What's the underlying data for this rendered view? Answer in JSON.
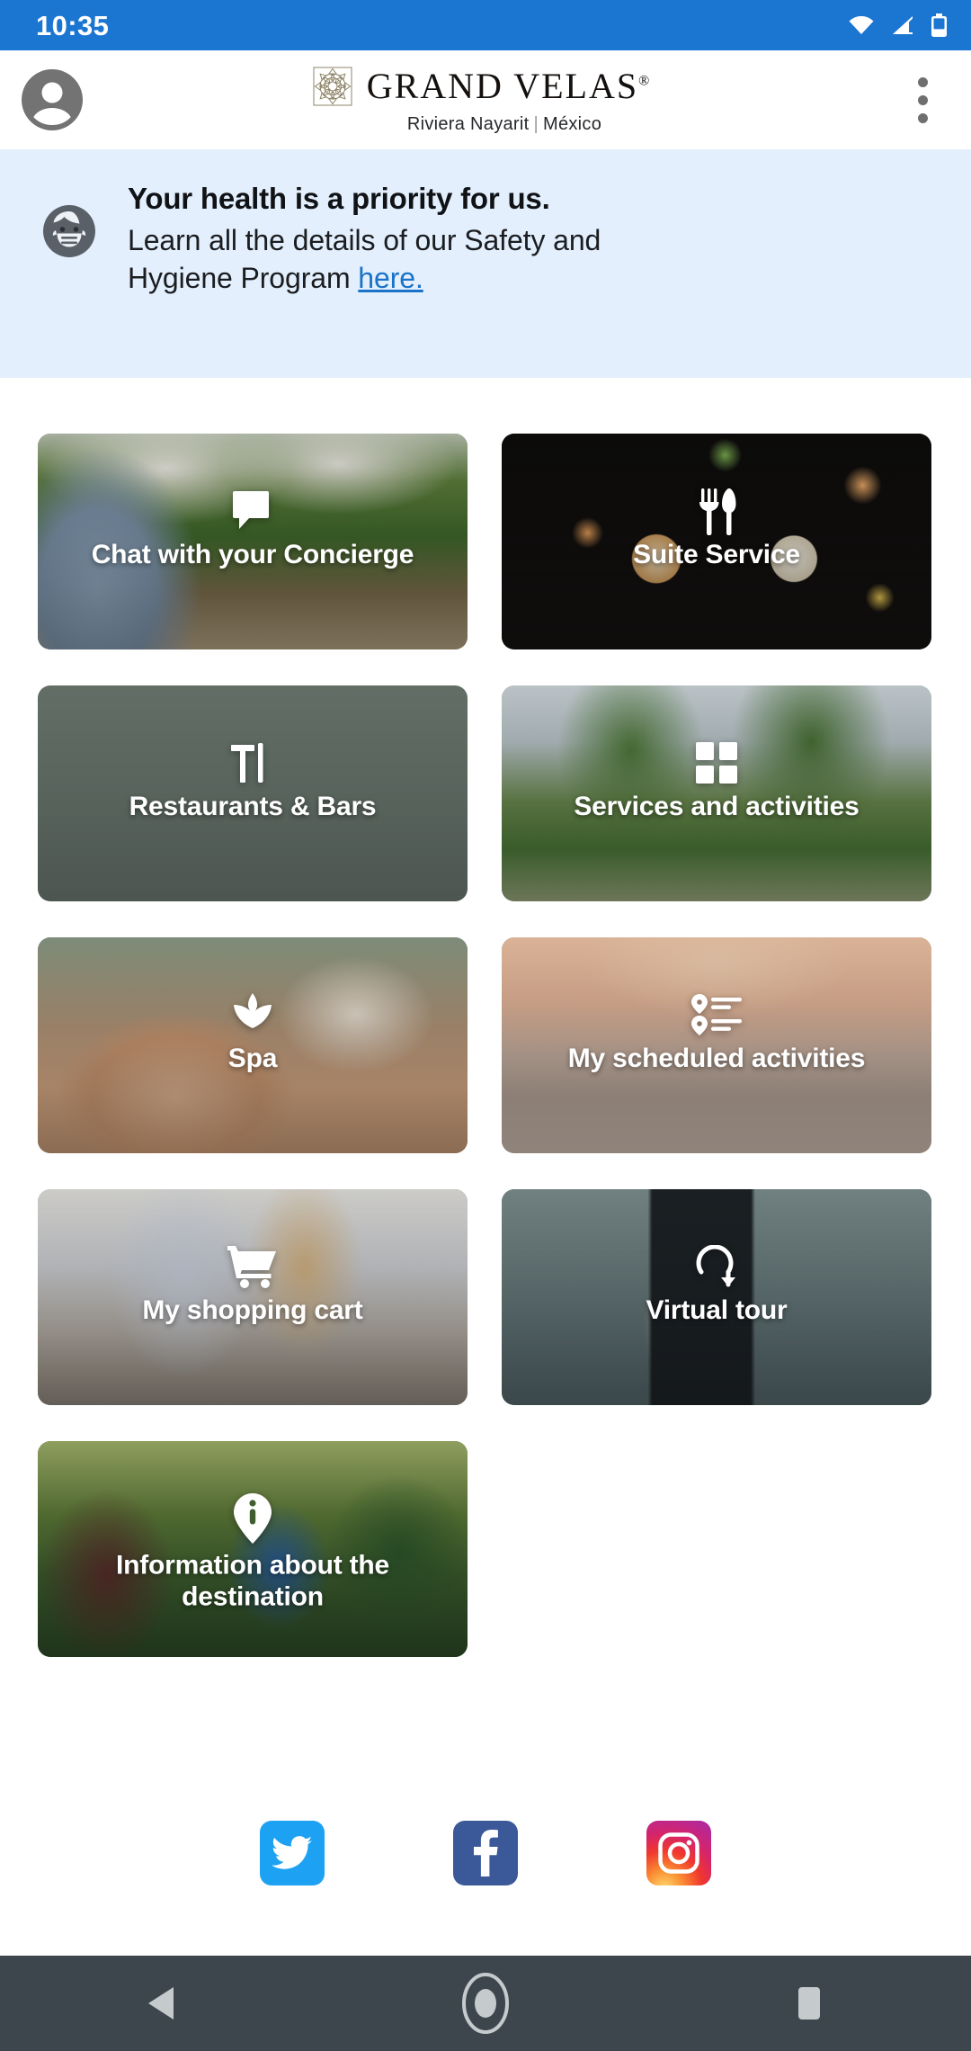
{
  "status_bar": {
    "time": "10:35",
    "background": "#1B76D2",
    "icons": [
      "wifi-icon",
      "cellular-signal-icon",
      "battery-icon"
    ]
  },
  "app_bar": {
    "avatar": "account-avatar-icon",
    "brand_name": "GRAND VELAS",
    "brand_registered": "®",
    "brand_subtitle_left": "Riviera Nayarit",
    "brand_subtitle_divider": "|",
    "brand_subtitle_right": "México",
    "emblem": "mandala-emblem-icon",
    "overflow_menu": "more-vertical-icon"
  },
  "health_banner": {
    "icon": "face-with-medical-mask-icon",
    "title": "Your health is a priority for us.",
    "body_prefix": "Learn all the details of our Safety and Hygiene Program ",
    "link_text": "here.",
    "background": "#E3EFFC",
    "link_color": "#1A73C8"
  },
  "tiles": [
    {
      "label": "Chat with your Concierge",
      "icon": "chat-bubble-icon"
    },
    {
      "label": "Suite Service",
      "icon": "fork-knife-icon"
    },
    {
      "label": "Restaurants & Bars",
      "icon": "dining-table-icon"
    },
    {
      "label": "Services and activities",
      "icon": "grid-four-squares-icon"
    },
    {
      "label": "Spa",
      "icon": "lotus-flower-icon"
    },
    {
      "label": "My scheduled activities",
      "icon": "agenda-list-icon"
    },
    {
      "label": "My shopping cart",
      "icon": "shopping-cart-icon"
    },
    {
      "label": "Virtual tour",
      "icon": "rotate-360-icon"
    },
    {
      "label": "Information about the destination",
      "icon": "info-pin-icon"
    }
  ],
  "social": [
    {
      "name": "Twitter",
      "icon": "twitter-icon",
      "color": "#1DA1F2"
    },
    {
      "name": "Facebook",
      "icon": "facebook-icon",
      "color": "#3B5998"
    },
    {
      "name": "Instagram",
      "icon": "instagram-icon",
      "color": "#D6246A"
    }
  ],
  "navigation_bar": {
    "background": "#3C464C",
    "back": "back-triangle-icon",
    "home": "home-circle-icon",
    "recents": "recents-square-icon"
  }
}
